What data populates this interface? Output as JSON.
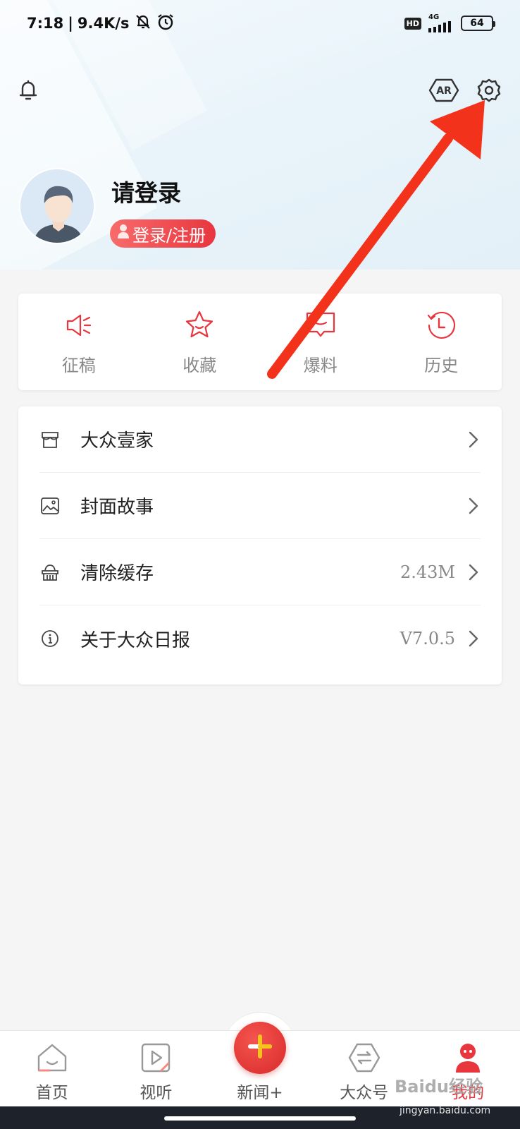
{
  "status_bar": {
    "time": "7:18",
    "speed": "9.4K/s",
    "network": "4G",
    "hd": "HD",
    "battery": "64"
  },
  "header": {
    "icons": [
      "bell-icon",
      "ar-icon",
      "gear-icon"
    ],
    "ar_label": "AR"
  },
  "profile": {
    "title": "请登录",
    "login_button": "登录/注册"
  },
  "quick_actions": [
    {
      "label": "征稿",
      "icon": "megaphone-icon"
    },
    {
      "label": "收藏",
      "icon": "star-icon"
    },
    {
      "label": "爆料",
      "icon": "chat-bubble-icon"
    },
    {
      "label": "历史",
      "icon": "history-clock-icon"
    }
  ],
  "menu": [
    {
      "label": "大众壹家",
      "icon": "shop-icon",
      "value": ""
    },
    {
      "label": "封面故事",
      "icon": "picture-icon",
      "value": ""
    },
    {
      "label": "清除缓存",
      "icon": "cleaner-icon",
      "value": "2.43M"
    },
    {
      "label": "关于大众日报",
      "icon": "info-icon",
      "value": "V7.0.5"
    }
  ],
  "bottom_nav": [
    {
      "label": "首页",
      "icon": "home-icon"
    },
    {
      "label": "视听",
      "icon": "play-icon"
    },
    {
      "label": "新闻+",
      "icon": "plus-icon"
    },
    {
      "label": "大众号",
      "icon": "exchange-icon"
    },
    {
      "label": "我的",
      "icon": "person-icon"
    }
  ],
  "watermark": {
    "text": "Baidu经验",
    "sub": "jingyan.baidu.com"
  },
  "colors": {
    "accent_red": "#e8363f",
    "annotation_arrow": "#f3321c",
    "bg_gray": "#f5f5f5"
  }
}
